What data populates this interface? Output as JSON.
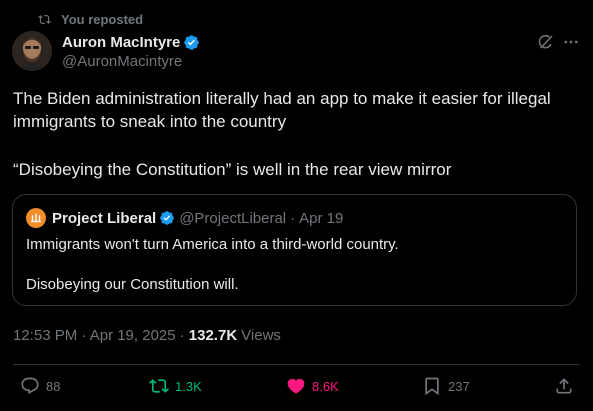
{
  "repost_banner": {
    "text": "You reposted"
  },
  "author": {
    "name": "Auron MacIntyre",
    "handle": "@AuronMacintyre",
    "verified": true
  },
  "post": {
    "line1": "The Biden administration literally had an app to make it easier for illegal",
    "line2": "immigrants to sneak into the country",
    "line3": "“Disobeying the Constitution” is well in the rear view mirror"
  },
  "quote": {
    "name": "Project Liberal",
    "handle": "@ProjectLiberal",
    "separator": "·",
    "date": "Apr 19",
    "line1": "Immigrants won't turn America into a third-world country.",
    "line2": "Disobeying our Constitution will."
  },
  "meta": {
    "timestamp": "12:53 PM · Apr 19, 2025 ·",
    "views_count": "132.7K",
    "views_label": "Views"
  },
  "actions": {
    "replies": "88",
    "reposts": "1.3K",
    "likes": "8.6K",
    "bookmarks": "237"
  },
  "colors": {
    "background": "#000000",
    "text": "#e7e9ea",
    "muted": "#71767b",
    "verified": "#1d9bf0",
    "repost_active": "#00ba7c",
    "like_active": "#f91880",
    "border": "#2f3336"
  },
  "icons": {
    "repost_banner": "repost-icon",
    "grok": "grok-icon",
    "more": "more-icon",
    "reply": "reply-icon",
    "repost": "repost-icon",
    "like": "heart-icon",
    "bookmark": "bookmark-icon",
    "share": "share-icon"
  }
}
